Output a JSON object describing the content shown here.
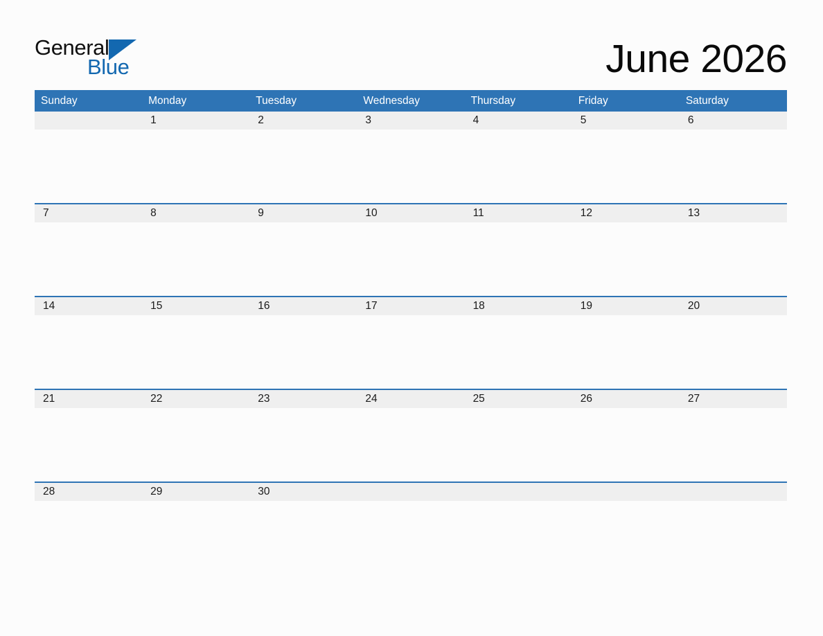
{
  "brand": {
    "name_part1": "General",
    "name_part2": "Blue",
    "triangle_color": "#1368b0",
    "text_color_primary": "#101010",
    "text_color_secondary": "#1368b0"
  },
  "header": {
    "title": "June 2026",
    "month": "June",
    "year": "2026"
  },
  "theme": {
    "accent_blue": "#2e74b5",
    "day_band_gray": "#efefef",
    "page_background": "#fcfcfc",
    "weekday_text": "#ffffff"
  },
  "calendar": {
    "weekdays": [
      "Sunday",
      "Monday",
      "Tuesday",
      "Wednesday",
      "Thursday",
      "Friday",
      "Saturday"
    ],
    "weeks": [
      {
        "rule_above": false,
        "days": [
          {
            "number": "",
            "events": ""
          },
          {
            "number": "1",
            "events": ""
          },
          {
            "number": "2",
            "events": ""
          },
          {
            "number": "3",
            "events": ""
          },
          {
            "number": "4",
            "events": ""
          },
          {
            "number": "5",
            "events": ""
          },
          {
            "number": "6",
            "events": ""
          }
        ]
      },
      {
        "rule_above": true,
        "days": [
          {
            "number": "7",
            "events": ""
          },
          {
            "number": "8",
            "events": ""
          },
          {
            "number": "9",
            "events": ""
          },
          {
            "number": "10",
            "events": ""
          },
          {
            "number": "11",
            "events": ""
          },
          {
            "number": "12",
            "events": ""
          },
          {
            "number": "13",
            "events": ""
          }
        ]
      },
      {
        "rule_above": true,
        "days": [
          {
            "number": "14",
            "events": ""
          },
          {
            "number": "15",
            "events": ""
          },
          {
            "number": "16",
            "events": ""
          },
          {
            "number": "17",
            "events": ""
          },
          {
            "number": "18",
            "events": ""
          },
          {
            "number": "19",
            "events": ""
          },
          {
            "number": "20",
            "events": ""
          }
        ]
      },
      {
        "rule_above": true,
        "days": [
          {
            "number": "21",
            "events": ""
          },
          {
            "number": "22",
            "events": ""
          },
          {
            "number": "23",
            "events": ""
          },
          {
            "number": "24",
            "events": ""
          },
          {
            "number": "25",
            "events": ""
          },
          {
            "number": "26",
            "events": ""
          },
          {
            "number": "27",
            "events": ""
          }
        ]
      },
      {
        "rule_above": true,
        "days": [
          {
            "number": "28",
            "events": ""
          },
          {
            "number": "29",
            "events": ""
          },
          {
            "number": "30",
            "events": ""
          },
          {
            "number": "",
            "events": ""
          },
          {
            "number": "",
            "events": ""
          },
          {
            "number": "",
            "events": ""
          },
          {
            "number": "",
            "events": ""
          }
        ]
      }
    ]
  }
}
